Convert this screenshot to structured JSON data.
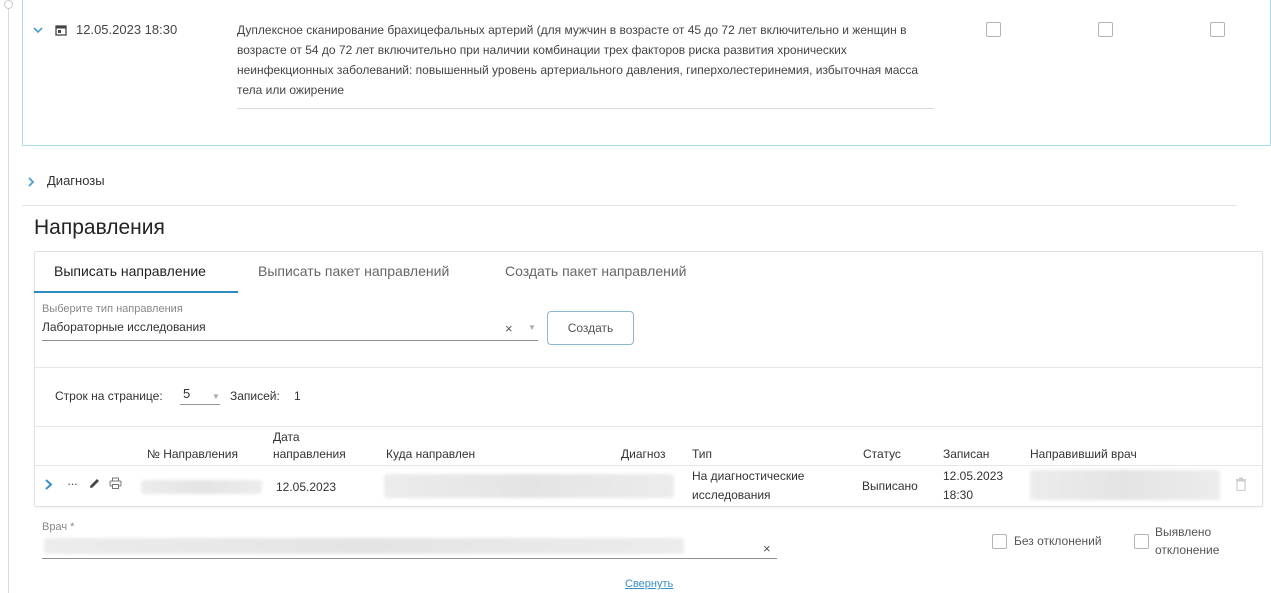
{
  "service": {
    "date": "12.05.2023 18:30",
    "description": "Дуплексное сканирование брахицефальных артерий (для мужчин в возрасте от 45 до 72 лет включительно и женщин в возрасте от 54 до 72 лет включительно при наличии комбинации трех факторов риска развития хронических неинфекционных заболеваний: повышенный уровень артериального давления, гиперхолестеринемия, избыточная масса тела или ожирение"
  },
  "diagnoses": {
    "label": "Диагнозы"
  },
  "section": {
    "title": "Направления"
  },
  "tabs": [
    {
      "label": "Выписать направление",
      "active": true
    },
    {
      "label": "Выписать пакет направлений",
      "active": false
    },
    {
      "label": "Создать пакет направлений",
      "active": false
    }
  ],
  "referral_type": {
    "label": "Выберите тип направления",
    "value": "Лабораторные исследования",
    "create_label": "Создать"
  },
  "pagination": {
    "rows_label": "Строк на странице:",
    "rows_value": "5",
    "records_label": "Записей:",
    "records_value": "1"
  },
  "table": {
    "headers": {
      "number": "№ Направления",
      "date": "Дата направления",
      "destination": "Куда направлен",
      "diagnosis": "Диагноз",
      "type": "Тип",
      "status": "Статус",
      "recorded": "Записан",
      "doctor": "Направивший врач"
    },
    "rows": [
      {
        "number": "",
        "date": "12.05.2023",
        "destination": "",
        "diagnosis": "",
        "type": "На диагностические исследования",
        "status": "Выписано",
        "recorded": "12.05.2023 18:30",
        "doctor": ""
      }
    ]
  },
  "doctor_field": {
    "label": "Врач *",
    "value": ""
  },
  "checkboxes": {
    "no_deviation": "Без отклонений",
    "deviation_found": "Выявлено отклонение"
  },
  "collapse_link": "Свернуть",
  "colors": {
    "accent": "#2e8bc0",
    "card_border": "#a9dbe8",
    "link": "#3a8fc4"
  }
}
